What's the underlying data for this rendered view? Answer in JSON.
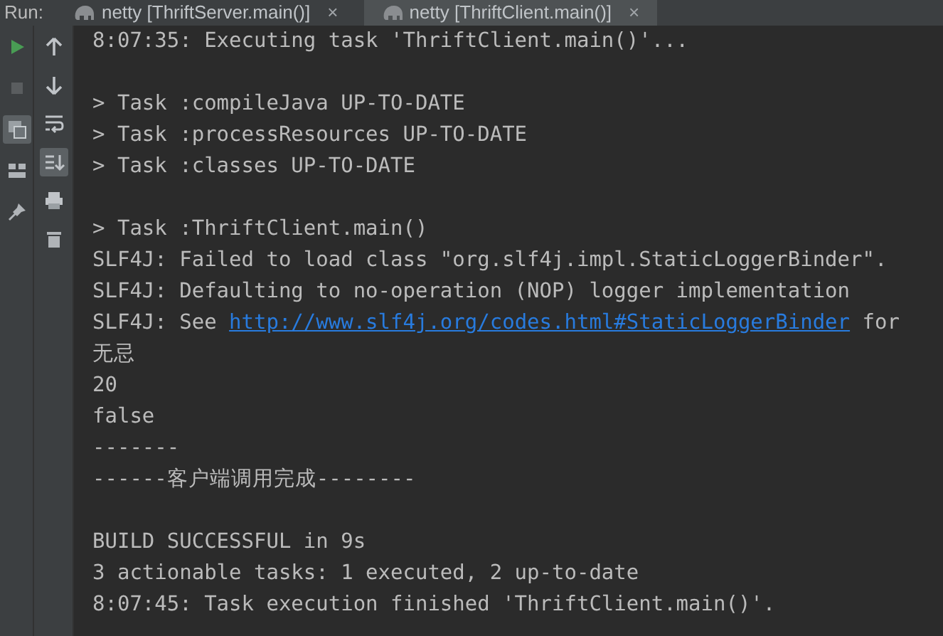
{
  "run_label": "Run:",
  "tabs": [
    {
      "label": "netty [ThriftServer.main()]",
      "close": "×",
      "selected": false
    },
    {
      "label": "netty [ThriftClient.main()]",
      "close": "×",
      "selected": true
    }
  ],
  "left_toolbar": [
    {
      "kind": "run",
      "selected": false
    },
    {
      "kind": "stop",
      "selected": false
    },
    {
      "kind": "restore",
      "selected": true
    },
    {
      "kind": "layout",
      "selected": false
    },
    {
      "kind": "pin",
      "selected": false
    }
  ],
  "right_toolbar": [
    {
      "kind": "up",
      "selected": false
    },
    {
      "kind": "down",
      "selected": false
    },
    {
      "kind": "wrap",
      "selected": false
    },
    {
      "kind": "scroll-end",
      "selected": true
    },
    {
      "kind": "print",
      "selected": false
    },
    {
      "kind": "trash",
      "selected": false
    }
  ],
  "console": [
    {
      "lines": [
        {
          "segments": [
            {
              "kind": "text",
              "text": "8:07:35: Executing task 'ThriftClient.main()'..."
            }
          ]
        }
      ]
    },
    {
      "lines": [
        {
          "segments": [
            {
              "kind": "text",
              "text": "> Task :compileJava UP-TO-DATE"
            }
          ]
        },
        {
          "segments": [
            {
              "kind": "text",
              "text": "> Task :processResources UP-TO-DATE"
            }
          ]
        },
        {
          "segments": [
            {
              "kind": "text",
              "text": "> Task :classes UP-TO-DATE"
            }
          ]
        }
      ]
    },
    {
      "lines": [
        {
          "segments": [
            {
              "kind": "text",
              "text": "> Task :ThriftClient.main()"
            }
          ]
        },
        {
          "segments": [
            {
              "kind": "text",
              "text": "SLF4J: Failed to load class \"org.slf4j.impl.StaticLoggerBinder\"."
            }
          ]
        },
        {
          "segments": [
            {
              "kind": "text",
              "text": "SLF4J: Defaulting to no-operation (NOP) logger implementation"
            }
          ]
        },
        {
          "segments": [
            {
              "kind": "text",
              "text": "SLF4J: See "
            },
            {
              "kind": "link",
              "text": "http://www.slf4j.org/codes.html#StaticLoggerBinder"
            },
            {
              "kind": "text",
              "text": " for"
            }
          ]
        },
        {
          "segments": [
            {
              "kind": "text",
              "text": "无忌"
            }
          ]
        },
        {
          "segments": [
            {
              "kind": "text",
              "text": "20"
            }
          ]
        },
        {
          "segments": [
            {
              "kind": "text",
              "text": "false"
            }
          ]
        },
        {
          "segments": [
            {
              "kind": "text",
              "text": "-------"
            }
          ]
        },
        {
          "segments": [
            {
              "kind": "text",
              "text": "------客户端调用完成--------"
            }
          ]
        }
      ]
    },
    {
      "lines": [
        {
          "segments": [
            {
              "kind": "text",
              "text": "BUILD SUCCESSFUL in 9s"
            }
          ]
        },
        {
          "segments": [
            {
              "kind": "text",
              "text": "3 actionable tasks: 1 executed, 2 up-to-date"
            }
          ]
        },
        {
          "segments": [
            {
              "kind": "text",
              "text": "8:07:45: Task execution finished 'ThriftClient.main()'."
            }
          ]
        }
      ]
    }
  ]
}
